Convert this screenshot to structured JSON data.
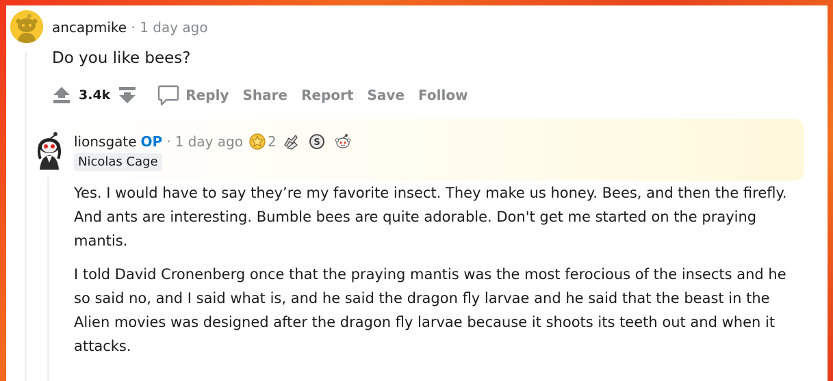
{
  "comment": {
    "author": "ancapmike",
    "separator": "·",
    "time": "1 day ago",
    "body": "Do you like bees?",
    "score": "3.4k",
    "actions": {
      "reply": "Reply",
      "share": "Share",
      "report": "Report",
      "save": "Save",
      "follow": "Follow"
    }
  },
  "reply": {
    "author": "lionsgate",
    "op_badge": "OP",
    "separator": "·",
    "time": "1 day ago",
    "award_count": "2",
    "awards": [
      "gold-star-award-icon",
      "silver-hands-award-icon",
      "silver-coin-award-icon",
      "snoo-award-icon"
    ],
    "flair": "Nicolas Cage",
    "paragraphs": [
      "Yes. I would have to say they’re my favorite insect. They make us honey. Bees, and then the firefly. And ants are interesting. Bumble bees are quite adorable. Don't get me started on the praying mantis.",
      "I told David Cronenberg once that the praying mantis was the most ferocious of the insects and he so said no, and I said what is, and he said the dragon fly larvae and he said that the beast in the Alien movies was designed after the dragon fly larvae because it shoots its teeth out and when it attacks."
    ]
  },
  "colors": {
    "background_orange": "#f26a1f",
    "background_red": "#e53a1c",
    "avatar_yellow": "#f7c630",
    "op_blue": "#0079d3",
    "muted_text": "#878a8c",
    "text": "#1c1c1c"
  }
}
